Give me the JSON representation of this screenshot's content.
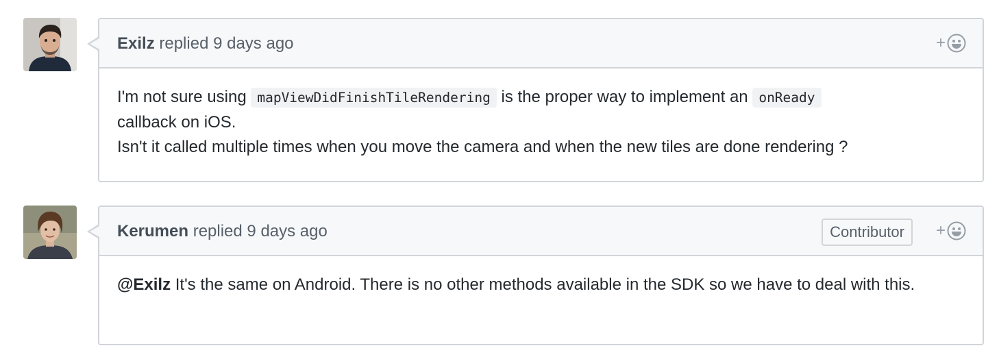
{
  "comments": [
    {
      "author": "Exilz",
      "action": " replied ",
      "time": "9 days ago",
      "reaction_plus": "+",
      "body": {
        "t1": "I'm not sure using ",
        "code1": "mapViewDidFinishTileRendering",
        "t2": " is the proper way to implement an ",
        "code2": "onReady",
        "t3": "callback on iOS.",
        "line2": "Isn't it called multiple times when you move the camera and when the new tiles are done rendering ?"
      }
    },
    {
      "author": "Kerumen",
      "action": " replied ",
      "time": "9 days ago",
      "badge": "Contributor",
      "reaction_plus": "+",
      "body": {
        "mention": "@Exilz",
        "text": " It's the same on Android. There is no other methods available in the SDK so we have to deal with this."
      }
    }
  ],
  "colors": {
    "border": "#d1d5da",
    "header_bg": "#f6f8fa",
    "text": "#24292e",
    "muted": "#586069",
    "code_bg": "#f1f2f4"
  }
}
